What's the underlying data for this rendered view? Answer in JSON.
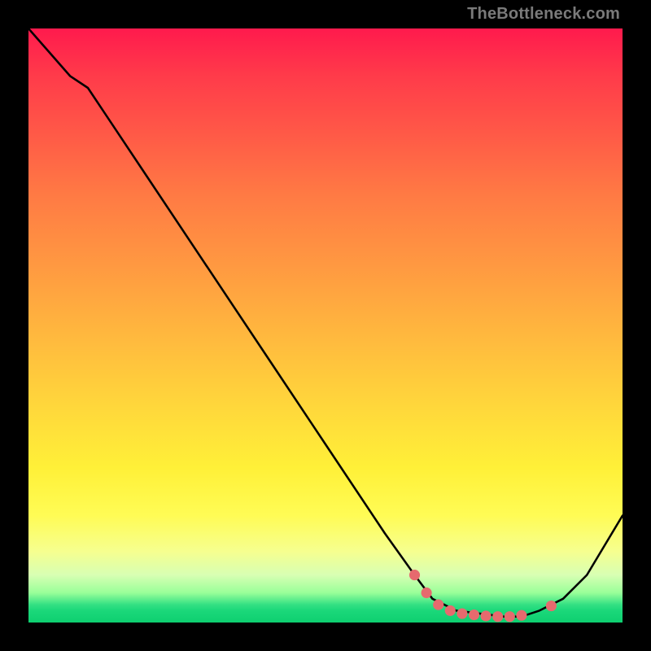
{
  "watermark": "TheBottleneck.com",
  "colors": {
    "background": "#000000",
    "gradient_top": "#ff1a4d",
    "gradient_bottom": "#0ecf70",
    "curve": "#000000",
    "marker": "#e66a6e"
  },
  "chart_data": {
    "type": "line",
    "title": "",
    "xlabel": "",
    "ylabel": "",
    "xlim": [
      0,
      100
    ],
    "ylim": [
      0,
      100
    ],
    "series": [
      {
        "name": "bottleneck-curve",
        "x": [
          0,
          7,
          10,
          20,
          30,
          40,
          50,
          60,
          65,
          68,
          72,
          76,
          80,
          83,
          86,
          90,
          94,
          100
        ],
        "y": [
          100,
          92,
          90,
          75,
          60,
          45,
          30,
          15,
          8,
          4,
          2,
          1.5,
          1,
          1,
          2,
          4,
          8,
          18
        ]
      }
    ],
    "markers": {
      "name": "highlighted-range",
      "color": "#e66a6e",
      "points": [
        {
          "x": 65,
          "y": 8
        },
        {
          "x": 67,
          "y": 5
        },
        {
          "x": 69,
          "y": 3
        },
        {
          "x": 71,
          "y": 2
        },
        {
          "x": 73,
          "y": 1.5
        },
        {
          "x": 75,
          "y": 1.3
        },
        {
          "x": 77,
          "y": 1.1
        },
        {
          "x": 79,
          "y": 1
        },
        {
          "x": 81,
          "y": 1
        },
        {
          "x": 83,
          "y": 1.2
        },
        {
          "x": 88,
          "y": 2.8
        }
      ]
    }
  }
}
